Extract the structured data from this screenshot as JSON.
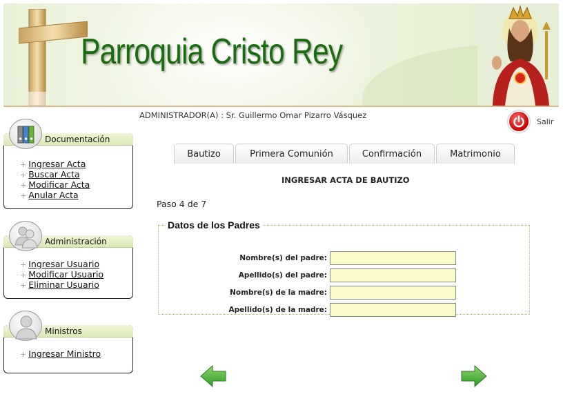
{
  "header": {
    "title": "Parroquia Cristo Rey",
    "user_line": "ADMINISTRADOR(A) : Sr. Guillermo Omar Pizarro Vásquez",
    "logout_label": "Salir"
  },
  "sidebar": {
    "documentacion": {
      "title": "Documentación",
      "items": [
        "Ingresar Acta",
        "Buscar Acta",
        "Modificar Acta",
        "Anular Acta"
      ]
    },
    "administracion": {
      "title": "Administración",
      "items": [
        "Ingresar Usuario",
        "Modificar Usuario",
        "Eliminar Usuario"
      ]
    },
    "ministros": {
      "title": "Ministros",
      "items": [
        "Ingresar Ministro"
      ]
    }
  },
  "tabs": [
    "Bautizo",
    "Primera Comunión",
    "Confirmación",
    "Matrimonio"
  ],
  "main": {
    "heading": "INGRESAR ACTA DE BAUTIZO",
    "step": "Paso 4 de 7",
    "fieldset_title": "Datos de los Padres",
    "fields": {
      "padre_nombre": {
        "label": "Nombre(s) del padre:",
        "value": ""
      },
      "padre_apellido": {
        "label": "Apellido(s) del padre:",
        "value": ""
      },
      "madre_nombre": {
        "label": "Nombre(s) de la madre:",
        "value": ""
      },
      "madre_apellido": {
        "label": "Apellido(s) de la madre:",
        "value": ""
      }
    }
  },
  "colors": {
    "title_green": "#1a6b12",
    "panel_header": "#dbe8b6",
    "input_bg": "#fbfbc9",
    "arrow_green": "#3aa935",
    "logout_red": "#c40000"
  },
  "icons": {
    "documentacion": "binders-icon",
    "administracion": "users-icon",
    "ministros": "user-icon",
    "logout": "power-icon",
    "back": "arrow-left-icon",
    "next": "arrow-right-icon"
  }
}
